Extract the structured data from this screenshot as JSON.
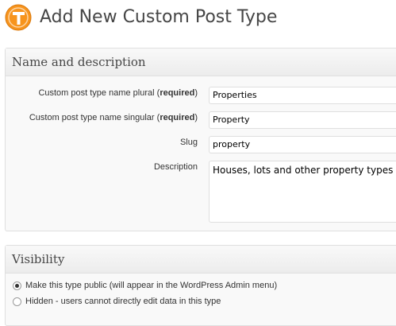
{
  "header": {
    "title": "Add New Custom Post Type",
    "logo_icon": "types-logo-icon"
  },
  "name_section": {
    "heading": "Name and description",
    "fields": [
      {
        "label": "Custom post type name plural",
        "required": "required",
        "value": "Properties"
      },
      {
        "label": "Custom post type name singular",
        "required": "required",
        "value": "Property"
      },
      {
        "label": "Slug",
        "value": "property"
      },
      {
        "label": "Description",
        "value": "Houses, lots and other property types"
      }
    ]
  },
  "visibility_section": {
    "heading": "Visibility",
    "options": [
      {
        "label": "Make this type public (will appear in the WordPress Admin menu)",
        "checked": true
      },
      {
        "label": "Hidden - users cannot directly edit data in this type",
        "checked": false
      }
    ]
  },
  "colors": {
    "logo_orange": "#f7941d",
    "panel_border": "#dfdfdf"
  }
}
